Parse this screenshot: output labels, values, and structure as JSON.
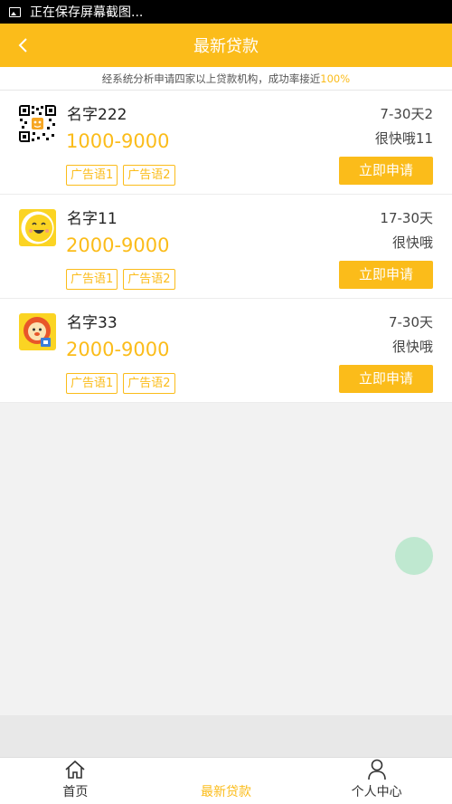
{
  "statusbar": {
    "text": "正在保存屏幕截图..."
  },
  "navbar": {
    "title": "最新贷款"
  },
  "notice": {
    "text": "经系统分析申请四家以上贷款机构，成功率接近",
    "percent": "100%"
  },
  "items": [
    {
      "name": "名字222",
      "amount": "1000-9000",
      "tags": [
        "广告语1",
        "广告语2"
      ],
      "term": "7-30天2",
      "speed": "很快哦11",
      "apply_label": "立即申请",
      "logo": "qr-code-icon"
    },
    {
      "name": "名字11",
      "amount": "2000-9000",
      "tags": [
        "广告语1",
        "广告语2"
      ],
      "term": "17-30天",
      "speed": "很快哦",
      "apply_label": "立即申请",
      "logo": "smiley-icon"
    },
    {
      "name": "名字33",
      "amount": "2000-9000",
      "tags": [
        "广告语1",
        "广告语2"
      ],
      "term": "7-30天",
      "speed": "很快哦",
      "apply_label": "立即申请",
      "logo": "lion-icon"
    }
  ],
  "tabs": [
    {
      "label": "首页",
      "icon": "home-icon"
    },
    {
      "label": "最新贷款",
      "icon": "loan-icon",
      "active": true
    },
    {
      "label": "个人中心",
      "icon": "person-icon"
    }
  ],
  "colors": {
    "accent": "#fbbc1a"
  }
}
